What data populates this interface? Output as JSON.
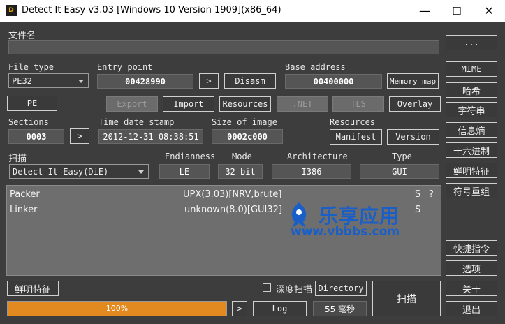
{
  "window": {
    "title": "Detect It Easy v3.03 [Windows 10 Version 1909](x86_64)",
    "icon_text": "D",
    "controls": {
      "minimize": "—",
      "maximize": "☐",
      "close": "✕"
    }
  },
  "file": {
    "label": "文件名",
    "path": "",
    "browse_label": "..."
  },
  "info": {
    "file_type_label": "File type",
    "file_type_value": "PE32",
    "entry_point_label": "Entry point",
    "entry_point_value": "00428990",
    "entry_go_label": ">",
    "disasm_label": "Disasm",
    "base_address_label": "Base address",
    "base_address_value": "00400000",
    "memory_map_label": "Memory map",
    "mime_label": "MIME",
    "pe_label": "PE",
    "export_label": "Export",
    "import_label": "Import",
    "resources_btn_label": "Resources",
    "net_label": ".NET",
    "tls_label": "TLS",
    "overlay_label": "Overlay",
    "sections_label": "Sections",
    "sections_value": "0003",
    "sections_go_label": ">",
    "timestamp_label": "Time date stamp",
    "timestamp_value": "2012-12-31 08:38:51",
    "size_label": "Size of image",
    "size_value": "0002c000",
    "resources_label": "Resources",
    "manifest_label": "Manifest",
    "version_label": "Version"
  },
  "scan": {
    "label": "扫描",
    "engine_value": "Detect It Easy(DiE)",
    "endianness_label": "Endianness",
    "endianness_value": "LE",
    "mode_label": "Mode",
    "mode_value": "32-bit",
    "architecture_label": "Architecture",
    "architecture_value": "I386",
    "type_label": "Type",
    "type_value": "GUI"
  },
  "results": [
    {
      "kind": "Packer",
      "value": "UPX(3.03)[NRV,brute]",
      "flag": "S",
      "extra": "?"
    },
    {
      "kind": "Linker",
      "value": "unknown(8.0)[GUI32]",
      "flag": "S",
      "extra": ""
    }
  ],
  "watermark": {
    "cn": "乐享应用",
    "url": "www.vbbbs.com"
  },
  "sidebar": [
    {
      "label": "哈希"
    },
    {
      "label": "字符串"
    },
    {
      "label": "信息熵"
    },
    {
      "label": "十六进制"
    },
    {
      "label": "鲜明特征"
    },
    {
      "label": "符号重组"
    }
  ],
  "bottom_right": [
    {
      "label": "快捷指令"
    },
    {
      "label": "选项"
    },
    {
      "label": "关于"
    },
    {
      "label": "退出"
    }
  ],
  "bottom": {
    "signatures_label": "鲜明特征",
    "deep_scan_label": "深度扫描",
    "deep_scan_checked": false,
    "directory_label": "Directory",
    "scan_label": "扫描",
    "progress_text": "100%",
    "progress": 1.0,
    "progress_go_label": ">",
    "log_label": "Log",
    "time_text": "55 毫秒"
  },
  "colors": {
    "progress_fill": "#e2891f",
    "background": "#3d3d3d",
    "results_bg": "#6e6e6e",
    "watermark": "#1a5fc7"
  }
}
